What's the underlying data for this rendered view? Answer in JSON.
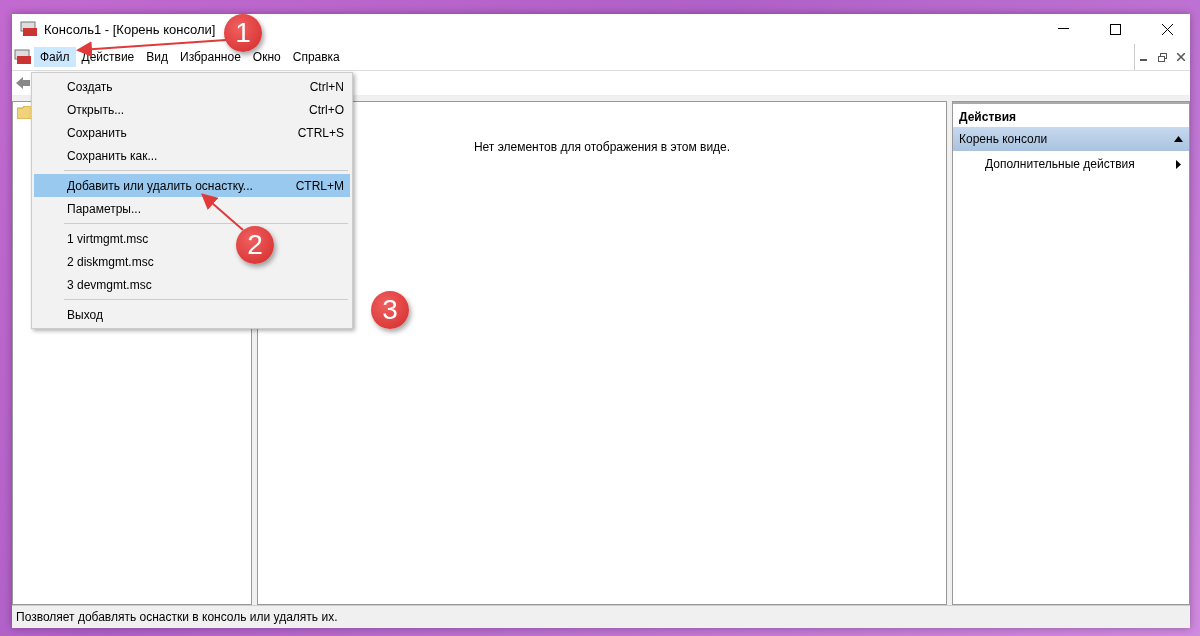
{
  "window": {
    "title": "Консоль1 - [Корень консоли]"
  },
  "menu_bar": [
    {
      "label": "Файл",
      "selected": true
    },
    {
      "label": "Действие",
      "selected": false
    },
    {
      "label": "Вид",
      "selected": false
    },
    {
      "label": "Избранное",
      "selected": false
    },
    {
      "label": "Окно",
      "selected": false
    },
    {
      "label": "Справка",
      "selected": false
    }
  ],
  "file_menu": {
    "groups": [
      [
        {
          "label": "Создать",
          "shortcut": "Ctrl+N",
          "selected": false
        },
        {
          "label": "Открыть...",
          "shortcut": "Ctrl+O",
          "selected": false
        },
        {
          "label": "Сохранить",
          "shortcut": "CTRL+S",
          "selected": false
        },
        {
          "label": "Сохранить как...",
          "selected": false
        }
      ],
      [
        {
          "label": "Добавить или удалить оснастку...",
          "shortcut": "CTRL+M",
          "selected": true
        },
        {
          "label": "Параметры...",
          "selected": false
        }
      ],
      [
        {
          "label": "1 virtmgmt.msc",
          "selected": false
        },
        {
          "label": "2 diskmgmt.msc",
          "selected": false
        },
        {
          "label": "3 devmgmt.msc",
          "selected": false
        }
      ],
      [
        {
          "label": "Выход",
          "selected": false
        }
      ]
    ]
  },
  "center_pane": {
    "empty_message": "Нет элементов для отображения в этом виде."
  },
  "actions_pane": {
    "title": "Действия",
    "items": [
      {
        "kind": "group",
        "label": "Корень консоли",
        "expanded": true
      },
      {
        "kind": "item",
        "label": "Дополнительные действия"
      }
    ]
  },
  "status_bar": "Позволяет добавлять оснастки в консоль или удалять их.",
  "annotations": [
    {
      "label": "1"
    },
    {
      "label": "2"
    },
    {
      "label": "3"
    }
  ]
}
